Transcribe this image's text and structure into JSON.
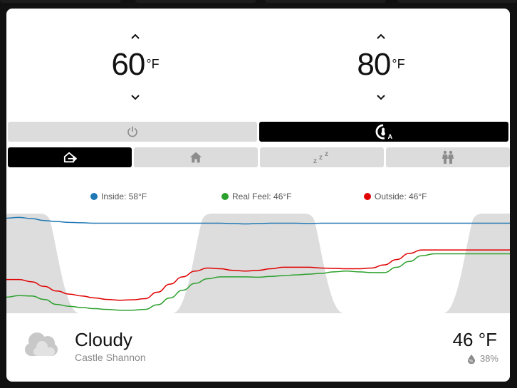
{
  "setpoints": {
    "low": {
      "value": "60",
      "unit": "°F"
    },
    "high": {
      "value": "80",
      "unit": "°F"
    }
  },
  "hvac_modes": [
    {
      "icon": "power-icon",
      "active": false
    },
    {
      "icon": "thermostat-auto-icon",
      "active": true
    }
  ],
  "presets": [
    {
      "icon": "away-icon",
      "active": true
    },
    {
      "icon": "home-icon",
      "active": false
    },
    {
      "icon": "sleep-icon",
      "active": false
    },
    {
      "icon": "people-icon",
      "active": false
    }
  ],
  "legend": [
    {
      "label": "Inside: 58°F",
      "color": "#1f77b4"
    },
    {
      "label": "Real Feel: 46°F",
      "color": "#2ca02c"
    },
    {
      "label": "Outside: 46°F",
      "color": "#e00000"
    }
  ],
  "chart_data": {
    "type": "line",
    "x": [
      0,
      1,
      2,
      3,
      4,
      5,
      6,
      7,
      8,
      9,
      10,
      11,
      12,
      13,
      14,
      15,
      16,
      17,
      18,
      19,
      20,
      21,
      22,
      23,
      24,
      25,
      26,
      27,
      28,
      29,
      30,
      31,
      32,
      33,
      34,
      35,
      36,
      37,
      38,
      39,
      40
    ],
    "series": [
      {
        "name": "Inside: 58°F",
        "color": "#1f77b4",
        "values": [
          59.8,
          60.0,
          59.7,
          59.2,
          58.9,
          58.7,
          58.6,
          58.5,
          58.5,
          58.5,
          58.5,
          58.5,
          58.5,
          58.5,
          58.5,
          58.5,
          58.5,
          58.5,
          58.4,
          58.3,
          58.4,
          58.5,
          58.5,
          58.5,
          58.4,
          58.5,
          58.5,
          58.5,
          58.5,
          58.5,
          58.5,
          58.5,
          58.5,
          58.5,
          58.5,
          58.5,
          58.5,
          58.5,
          58.5,
          58.5,
          58.5
        ]
      },
      {
        "name": "Real Feel: 46°F",
        "color": "#2ca02c",
        "values": [
          39.2,
          39.6,
          39.5,
          38.6,
          37.3,
          36.8,
          36.5,
          36.2,
          36.0,
          35.8,
          35.8,
          36.0,
          37.2,
          39.0,
          41.0,
          42.8,
          44.0,
          44.5,
          44.5,
          44.5,
          44.4,
          44.6,
          44.8,
          45.0,
          45.2,
          45.4,
          45.8,
          46.0,
          45.8,
          45.6,
          45.6,
          47.0,
          48.5,
          50.0,
          50.5,
          50.5,
          50.5,
          50.5,
          50.5,
          50.5,
          50.5
        ]
      },
      {
        "name": "Outside: 46°F",
        "color": "#e00000",
        "values": [
          43.8,
          43.8,
          43.2,
          42.0,
          40.8,
          40.0,
          39.5,
          39.0,
          38.6,
          38.4,
          38.5,
          38.8,
          40.5,
          42.6,
          44.5,
          46.0,
          46.8,
          46.6,
          46.2,
          46.0,
          46.2,
          46.6,
          47.0,
          47.0,
          47.0,
          46.8,
          46.7,
          46.6,
          46.6,
          46.8,
          47.6,
          49.0,
          50.6,
          51.5,
          51.5,
          51.5,
          51.5,
          51.5,
          51.5,
          51.5,
          51.5
        ]
      }
    ],
    "shaded_bands": [
      [
        -2,
        4
      ],
      [
        15,
        25
      ],
      [
        36.5,
        42
      ]
    ],
    "ylim": [
      35,
      61
    ]
  },
  "weather": {
    "condition": "Cloudy",
    "location": "Castle Shannon",
    "temperature": "46 °F",
    "humidity": "38%",
    "icon": "cloudy-icon"
  }
}
